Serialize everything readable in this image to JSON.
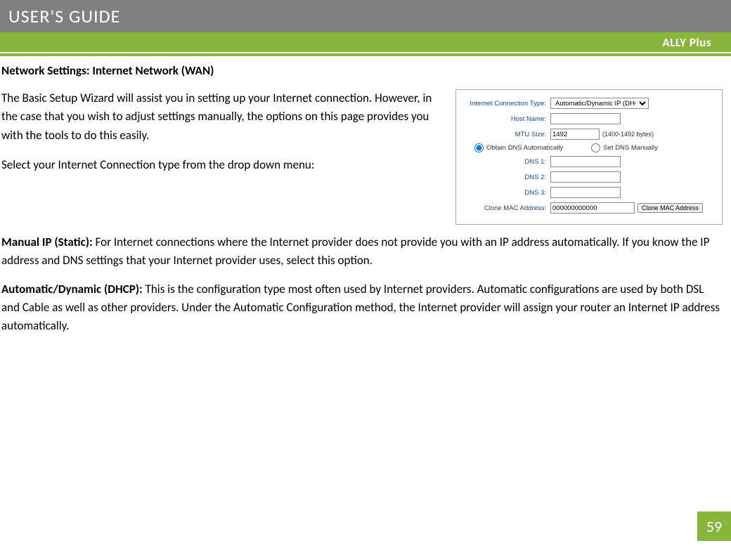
{
  "header": {
    "title": "USER'S GUIDE",
    "product": "ALLY Plus"
  },
  "section": {
    "title": "Network Settings: Internet Network (WAN)",
    "intro1": "The Basic Setup Wizard will assist you in setting up your Internet connection. However, in the case that you wish to adjust settings manually, the options on this page provides you with the tools to do this easily.",
    "intro2": "Select your Internet Connection type from the drop down menu:",
    "manual_label": "Manual IP (Static):",
    "manual_text": " For Internet connections where the Internet provider does not provide you with an IP address automatically. If you know the IP address and DNS settings that your Internet provider uses, select this option.",
    "auto_label": "Automatic/Dynamic (DHCP):",
    "auto_text": " This is the configuration type most often used by Internet providers. Automatic configurations are used by both DSL and Cable as well as other providers. Under the Automatic Configuration method, the Internet provider will assign your router an Internet IP address automatically."
  },
  "panel": {
    "labels": {
      "conn_type": "Internet Connection Type:",
      "host_name": "Host Name:",
      "mtu_size": "MTU Size:",
      "dns1": "DNS 1:",
      "dns2": "DNS 2:",
      "dns3": "DNS 3:",
      "clone_mac": "Clone MAC Address:"
    },
    "values": {
      "conn_type": "Automatic/Dynamic IP (DHCP)",
      "host_name": "",
      "mtu_size": "1492",
      "mtu_note": "(1400-1492 bytes)",
      "dns_auto": "Obtain DNS Automatically",
      "dns_manual": "Set DNS Manually",
      "dns1": "",
      "dns2": "",
      "dns3": "",
      "clone_mac": "000000000000",
      "clone_button": "Clone MAC Address"
    }
  },
  "page_number": "59"
}
